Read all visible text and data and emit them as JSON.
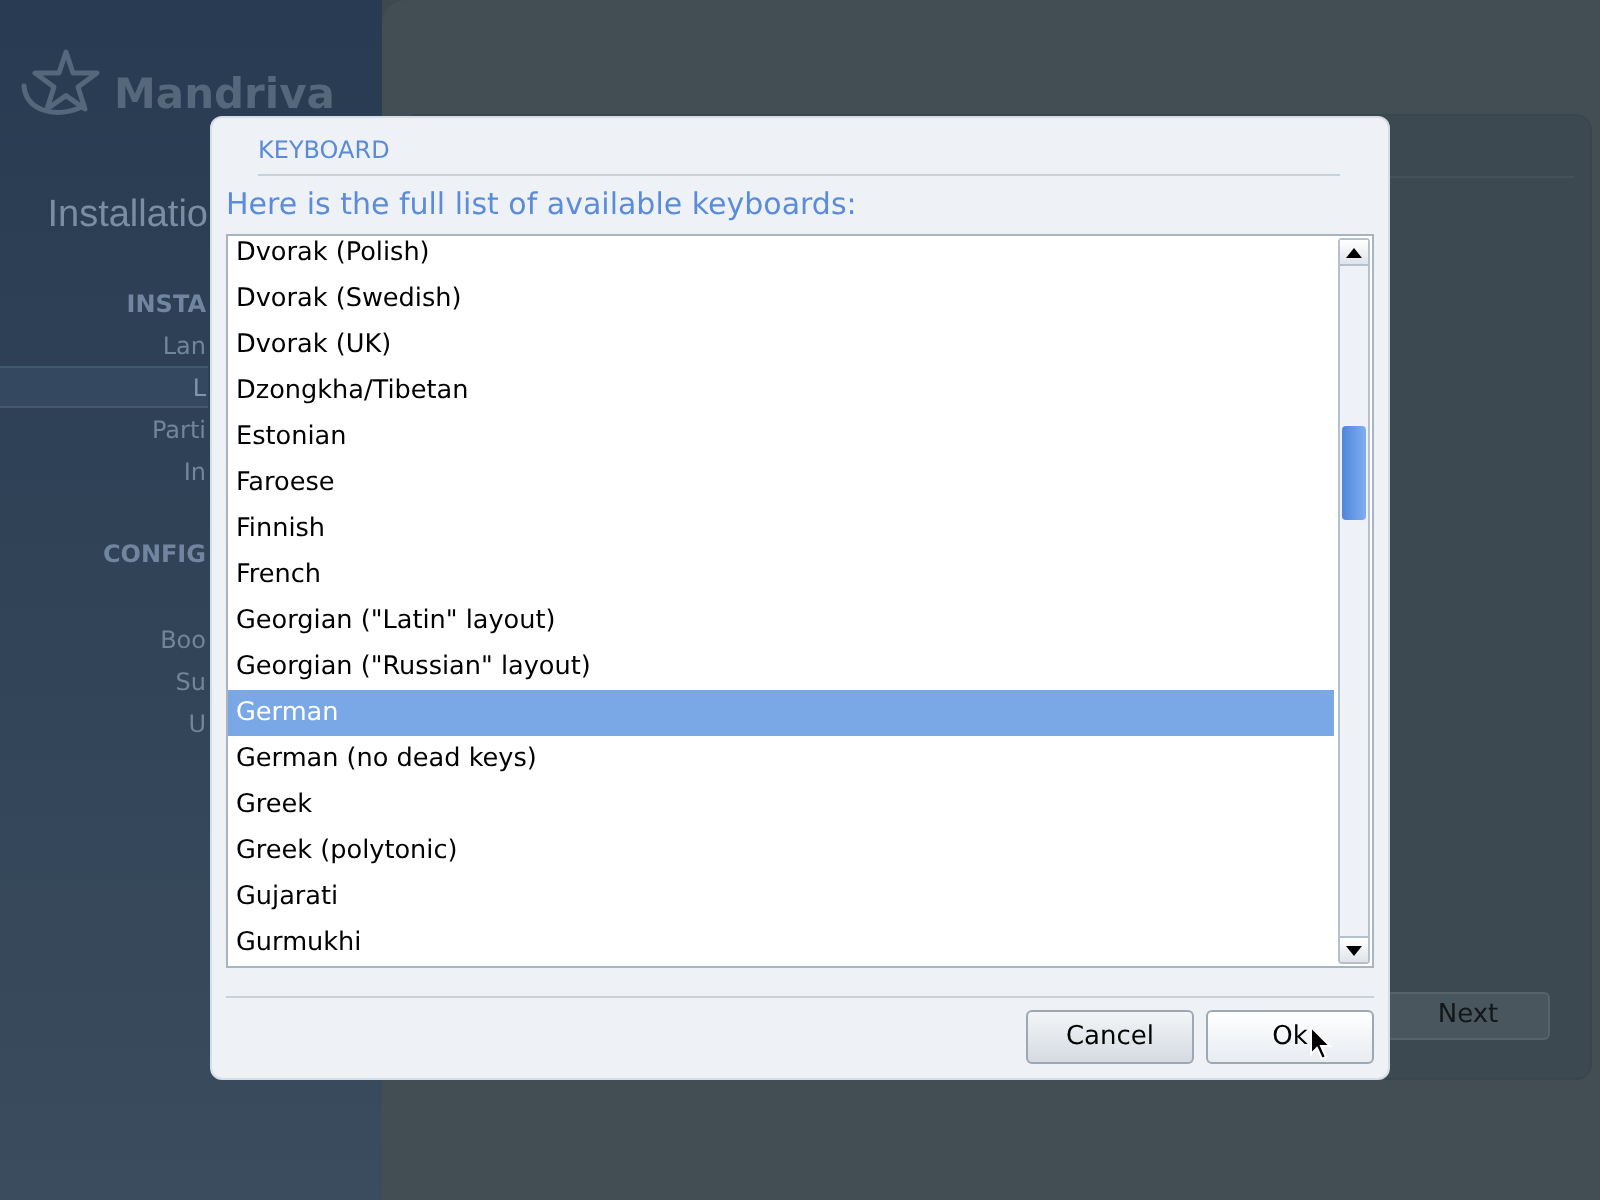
{
  "background": {
    "logo": {
      "text": "Mandriva"
    },
    "sidebar": {
      "title": "Installatio",
      "sections": [
        {
          "heading": "INSTA",
          "items": [
            {
              "label": "Lan",
              "selected": false
            },
            {
              "label": "L",
              "selected": true
            },
            {
              "label": "Parti",
              "selected": false
            },
            {
              "label": "In",
              "selected": false
            }
          ]
        },
        {
          "heading": "CONFIG",
          "items": [
            {
              "label": "Boo",
              "selected": false
            },
            {
              "label": "Su",
              "selected": false
            },
            {
              "label": "U",
              "selected": false
            }
          ]
        }
      ]
    },
    "next_button": {
      "label": "Next"
    }
  },
  "dialog": {
    "title": "KEYBOARD",
    "prompt": "Here is the full list of available keyboards:",
    "keyboards": [
      {
        "label": "Dvorak (Polish)",
        "selected": false
      },
      {
        "label": "Dvorak (Swedish)",
        "selected": false
      },
      {
        "label": "Dvorak (UK)",
        "selected": false
      },
      {
        "label": "Dzongkha/Tibetan",
        "selected": false
      },
      {
        "label": "Estonian",
        "selected": false
      },
      {
        "label": "Faroese",
        "selected": false
      },
      {
        "label": "Finnish",
        "selected": false
      },
      {
        "label": "French",
        "selected": false
      },
      {
        "label": "Georgian (\"Latin\" layout)",
        "selected": false
      },
      {
        "label": "Georgian (\"Russian\" layout)",
        "selected": false
      },
      {
        "label": "German",
        "selected": true
      },
      {
        "label": "German (no dead keys)",
        "selected": false
      },
      {
        "label": "Greek",
        "selected": false
      },
      {
        "label": "Greek (polytonic)",
        "selected": false
      },
      {
        "label": "Gujarati",
        "selected": false
      },
      {
        "label": "Gurmukhi",
        "selected": false
      }
    ],
    "buttons": [
      {
        "label": "Cancel",
        "hovered": false
      },
      {
        "label": "Ok",
        "hovered": true
      }
    ]
  }
}
